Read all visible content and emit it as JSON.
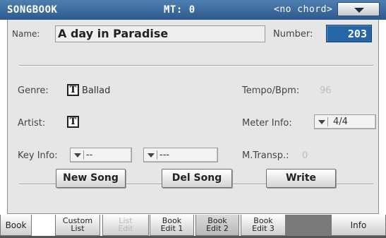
{
  "header": {
    "title": "SONGBOOK",
    "midi": "MT: 0",
    "chord": "<no chord>",
    "menu_icon": "chevron-down-icon"
  },
  "form": {
    "name_label": "Name:",
    "name_value": "A day in Paradise",
    "number_label": "Number:",
    "number_value": "203",
    "genre_label": "Genre:",
    "genre_value": "Ballad",
    "artist_label": "Artist:",
    "artist_value": "",
    "text_edit_icon_label": "T",
    "key_info_label": "Key Info:",
    "key_info_value_1": "--",
    "key_info_value_2": "---",
    "tempo_label": "Tempo/Bpm:",
    "tempo_value": "96",
    "meter_label": "Meter Info:",
    "meter_value": "4/4",
    "mtransp_label": "M.Transp.:",
    "mtransp_value": "0"
  },
  "buttons": {
    "new_song": "New Song",
    "del_song": "Del Song",
    "write": "Write"
  },
  "tabs": [
    {
      "line1": "Book",
      "line2": ""
    },
    {
      "line1": "Custom",
      "line2": "List"
    },
    {
      "line1": "List",
      "line2": "Edit"
    },
    {
      "line1": "Book",
      "line2": "Edit 1"
    },
    {
      "line1": "Book",
      "line2": "Edit 2"
    },
    {
      "line1": "Book",
      "line2": "Edit 3"
    },
    {
      "line1": "Info",
      "line2": ""
    }
  ],
  "active_tab": "Book Edit 2",
  "colors": {
    "header": "#2d5a8e",
    "number_field": "#2766a6",
    "panel": "#e6e6e6"
  }
}
